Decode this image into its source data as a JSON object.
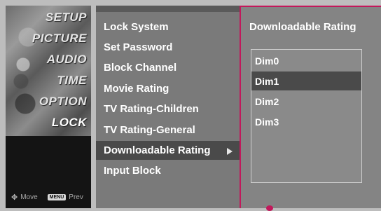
{
  "sidebar": {
    "tabs": [
      {
        "label": "SETUP"
      },
      {
        "label": "PICTURE"
      },
      {
        "label": "AUDIO"
      },
      {
        "label": "TIME"
      },
      {
        "label": "OPTION"
      },
      {
        "label": "LOCK"
      }
    ],
    "active_tab": "LOCK",
    "footer": {
      "move_icon": "four-way-arrow-icon",
      "move_label": "Move",
      "menu_key_label": "MENU",
      "prev_label": "Prev"
    }
  },
  "menu": {
    "items": [
      {
        "label": "Lock System"
      },
      {
        "label": "Set Password"
      },
      {
        "label": "Block Channel"
      },
      {
        "label": "Movie Rating"
      },
      {
        "label": "TV Rating-Children"
      },
      {
        "label": "TV Rating-General"
      },
      {
        "label": "Downloadable Rating"
      },
      {
        "label": "Input Block"
      }
    ],
    "selected_item": "Downloadable Rating",
    "arrow_icon": "arrow-right-icon"
  },
  "submenu": {
    "title": "Downloadable Rating",
    "options": [
      {
        "label": "Dim0"
      },
      {
        "label": "Dim1"
      },
      {
        "label": "Dim2"
      },
      {
        "label": "Dim3"
      }
    ],
    "selected_option": "Dim1"
  },
  "colors": {
    "accent_border": "#c2185b",
    "highlight": "#4a4a4a"
  }
}
